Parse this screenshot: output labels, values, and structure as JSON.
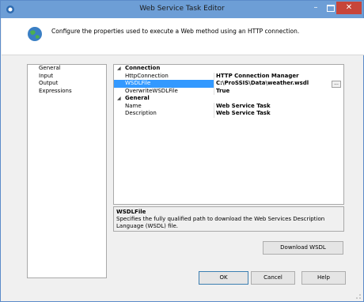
{
  "window": {
    "title": "Web Service Task Editor",
    "minimize_glyph": "–",
    "close_glyph": "✕"
  },
  "header": {
    "text": "Configure the properties used to execute a Web method using an HTTP connection."
  },
  "nav": {
    "items": [
      "General",
      "Input",
      "Output",
      "Expressions"
    ]
  },
  "grid": {
    "categories": [
      {
        "name": "Connection",
        "props": [
          {
            "name": "HttpConnection",
            "value": "HTTP Connection Manager"
          },
          {
            "name": "WSDLFile",
            "value": "C:\\ProSSIS\\Data\\weather.wsdl",
            "selected": true
          },
          {
            "name": "OverwriteWSDLFile",
            "value": "True"
          }
        ]
      },
      {
        "name": "General",
        "props": [
          {
            "name": "Name",
            "value": "Web Service Task"
          },
          {
            "name": "Description",
            "value": "Web Service Task"
          }
        ]
      }
    ],
    "ellipsis": "..."
  },
  "description": {
    "title": "WSDLFile",
    "text": "Specifies the fully qualified path to download the Web Services Description Language (WSDL) file."
  },
  "buttons": {
    "download": "Download WSDL",
    "ok": "OK",
    "cancel": "Cancel",
    "help": "Help"
  },
  "icons": {
    "app": "app-icon",
    "globe": "globe-icon"
  },
  "colors": {
    "titlebar": "#6d9ed6",
    "close": "#c7453a",
    "selection": "#3399ff"
  }
}
